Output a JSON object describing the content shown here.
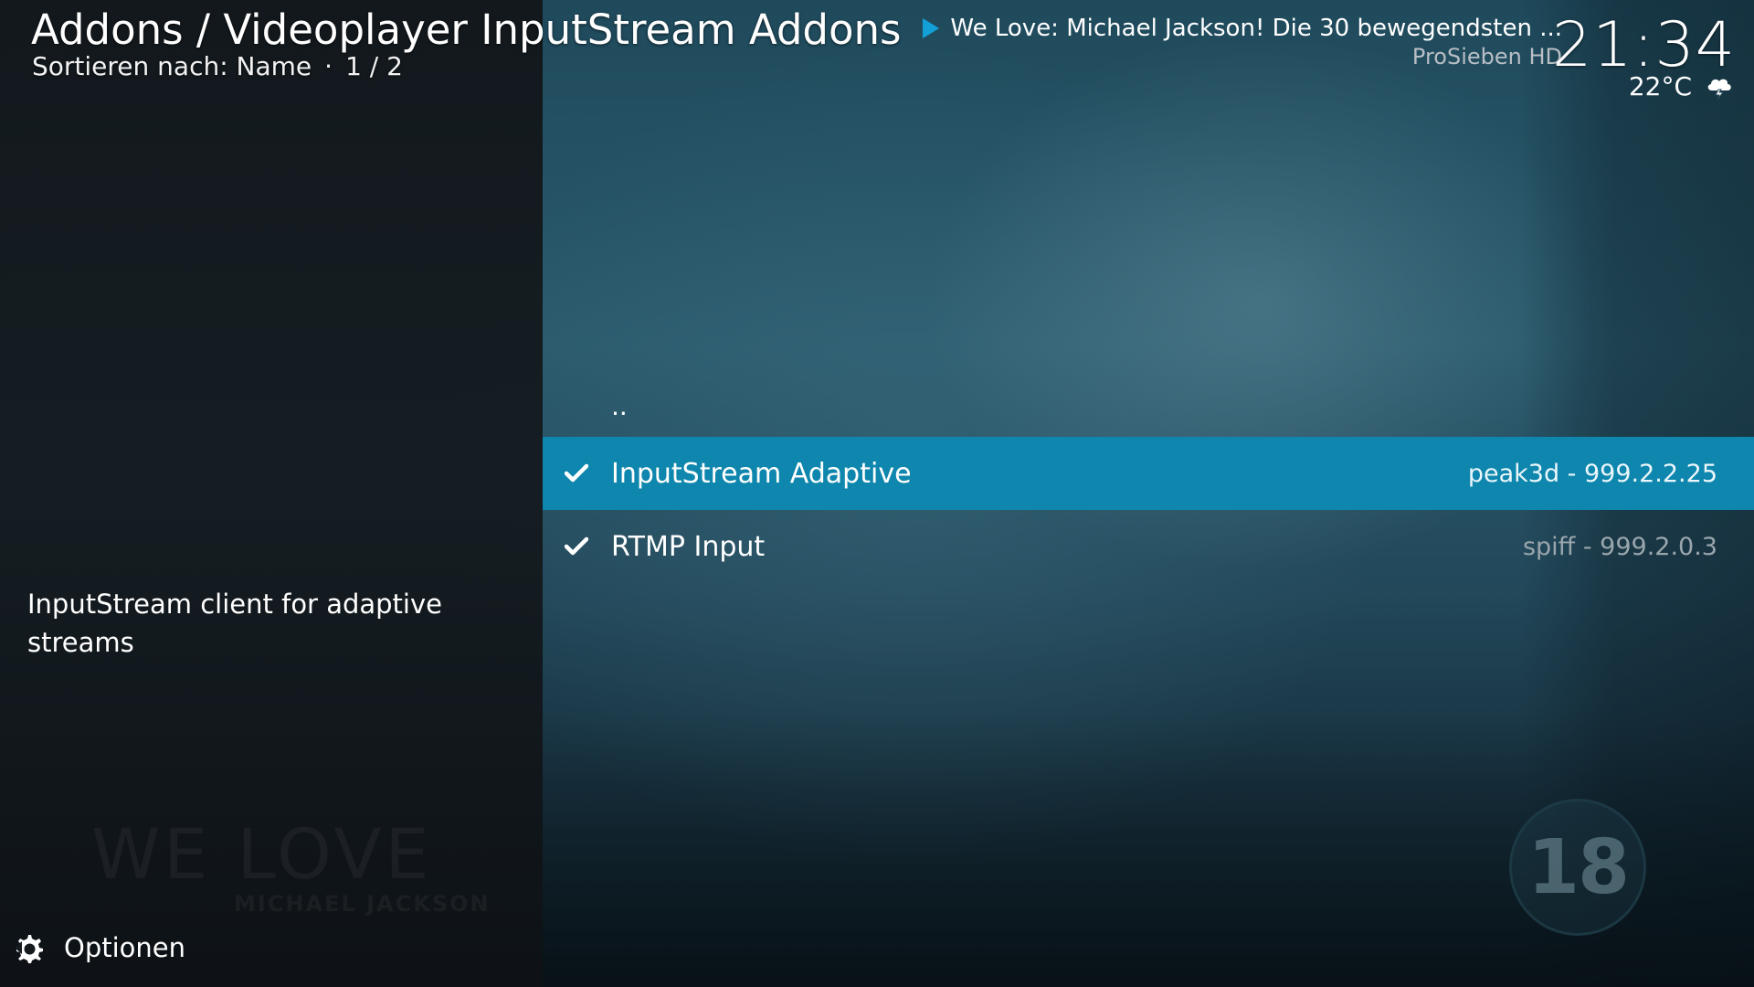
{
  "header": {
    "title": "Addons / Videoplayer InputStream Addons",
    "sort_label": "Sortieren nach: Name",
    "separator": "·",
    "page": "1 / 2"
  },
  "now_playing": {
    "title": "We Love: Michael Jackson! Die 30 bewegendsten ...",
    "channel": "ProSieben HD",
    "icon": "play-icon"
  },
  "clock": {
    "time": "21:34"
  },
  "weather": {
    "temperature": "22°C",
    "icon": "weather-cloud-lightning-icon"
  },
  "list": {
    "parent_label": "..",
    "items": [
      {
        "label": "InputStream Adaptive",
        "meta": "peak3d - 999.2.2.25",
        "checked": true,
        "selected": true
      },
      {
        "label": "RTMP Input",
        "meta": "spiff - 999.2.0.3",
        "checked": true,
        "selected": false
      }
    ]
  },
  "description": "InputStream client for adaptive streams",
  "options": {
    "label": "Optionen",
    "icon": "gear-icon"
  },
  "background": {
    "logo_text": "WE LOVE",
    "logo_subtext": "MICHAEL JACKSON",
    "age_rating": "18"
  },
  "colors": {
    "accent": "#12a0d7",
    "selected_row": "#0e86ad",
    "meta_text": "#9aa6ad",
    "channel_text": "#b8bec4"
  }
}
